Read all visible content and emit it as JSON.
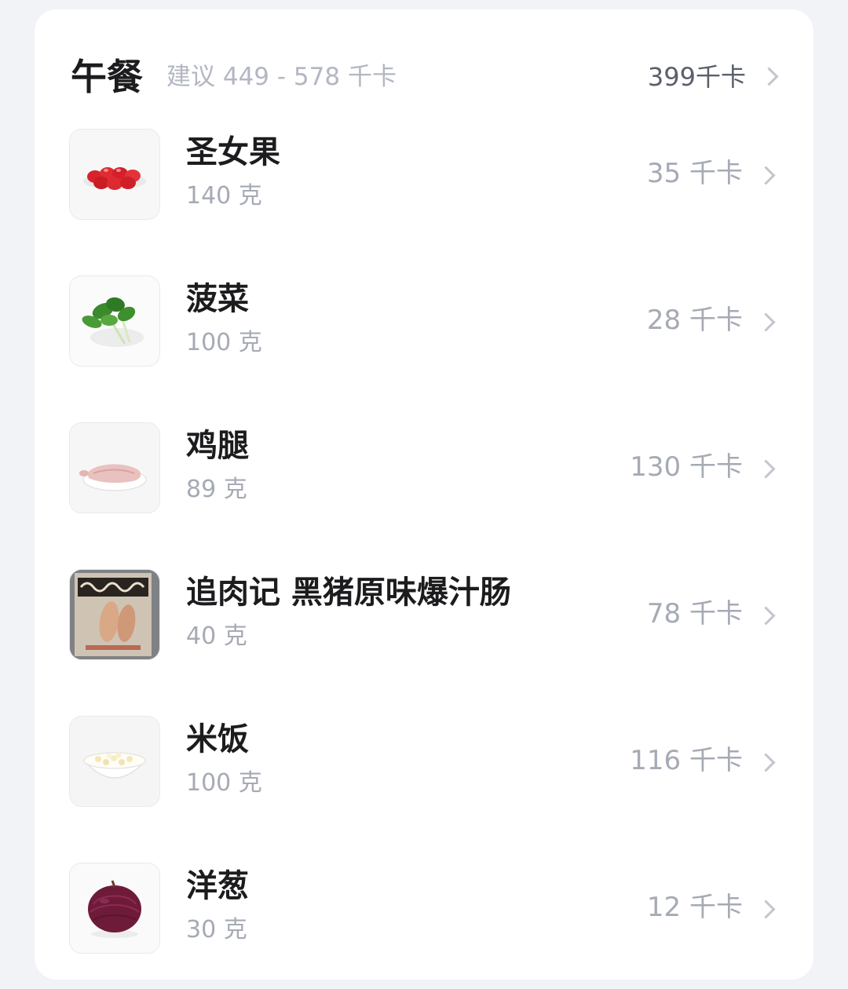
{
  "meal": {
    "title": "午餐",
    "suggestion": "建议 449 - 578 千卡",
    "total": "399千卡"
  },
  "foods": [
    {
      "name": "圣女果",
      "qty": "140 克",
      "kcal": "35 千卡",
      "icon": "cherry-tomato-image"
    },
    {
      "name": "菠菜",
      "qty": "100 克",
      "kcal": "28 千卡",
      "icon": "spinach-image"
    },
    {
      "name": "鸡腿",
      "qty": "89 克",
      "kcal": "130 千卡",
      "icon": "chicken-leg-image"
    },
    {
      "name": "追肉记 黑猪原味爆汁肠",
      "qty": "40 克",
      "kcal": "78 千卡",
      "icon": "sausage-package-image"
    },
    {
      "name": "米饭",
      "qty": "100 克",
      "kcal": "116 千卡",
      "icon": "rice-bowl-image"
    },
    {
      "name": "洋葱",
      "qty": "30 克",
      "kcal": "12 千卡",
      "icon": "onion-image"
    }
  ],
  "colors": {
    "background": "#f2f3f7",
    "card": "#ffffff",
    "title": "#1c1c1e",
    "muted": "#a6aab4"
  }
}
